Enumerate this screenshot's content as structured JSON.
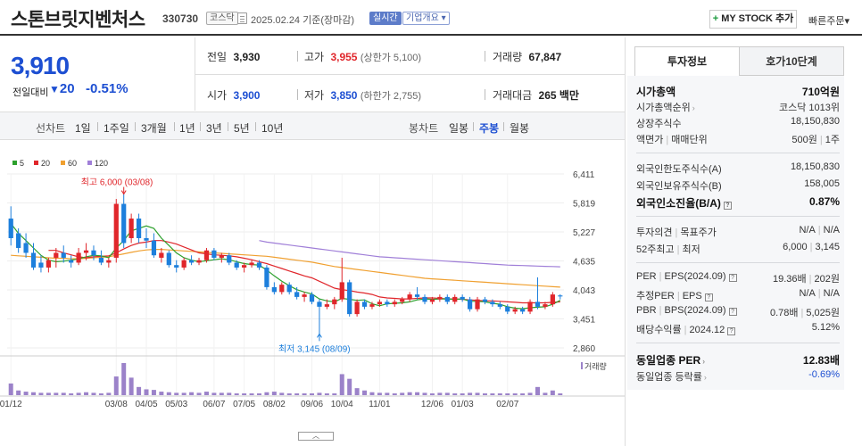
{
  "header": {
    "title": "스톤브릿지벤처스",
    "code": "330730",
    "market": "코스닥",
    "date": "2025.02.24",
    "date_suffix": "기준(장마감)",
    "realtime": "실시간",
    "company_overview": "기업개요",
    "mystock_plus": "+",
    "mystock": "MY STOCK 추가",
    "quick_order": "빠른주문"
  },
  "summary": {
    "price": "3,910",
    "change_label": "전일대비",
    "change_arrow": "▼",
    "change": "20",
    "change_rate": "-0.51%",
    "prev_label": "전일",
    "prev": "3,930",
    "high_label": "고가",
    "high": "3,955",
    "upper_limit": "(상한가 5,100)",
    "volume_label": "거래량",
    "volume": "67,847",
    "open_label": "시가",
    "open": "3,900",
    "low_label": "저가",
    "low": "3,850",
    "lower_limit": "(하한가 2,755)",
    "amount_label": "거래대금",
    "amount": "265 백만"
  },
  "period_tabs": {
    "line_chart": "선차트",
    "items": [
      "1일",
      "1주일",
      "3개월",
      "1년",
      "3년",
      "5년",
      "10년"
    ],
    "candle_chart": "봉차트",
    "candles": [
      "일봉",
      "주봉",
      "월봉"
    ],
    "active_candle": "주봉"
  },
  "colors": {
    "up": "#e0262b",
    "down": "#1d7fdc",
    "ma5": "#2ca02c",
    "ma20": "#e0262b",
    "ma60": "#f0a030",
    "ma120": "#a07fd8",
    "volume": "#9b82c9"
  },
  "chart_data": {
    "type": "candlestick",
    "legend": [
      "5",
      "20",
      "60",
      "120"
    ],
    "y_ticks": [
      "6,411",
      "5,819",
      "5,227",
      "4,635",
      "4,043",
      "3,451",
      "2,860"
    ],
    "ylim": [
      2860,
      6411
    ],
    "x_ticks": [
      "01/12",
      "03/08",
      "04/05",
      "05/03",
      "06/07",
      "07/05",
      "08/02",
      "09/06",
      "10/04",
      "11/01",
      "12/06",
      "01/03",
      "02/07"
    ],
    "high_annotation": "최고 6,000 (03/08)",
    "low_annotation": "최저 3,145 (08/09)",
    "volume_label": "거래량",
    "candles": [
      [
        5500,
        5750,
        4950,
        5100
      ],
      [
        5200,
        5300,
        4800,
        4900
      ],
      [
        5000,
        5200,
        4700,
        4800
      ],
      [
        4800,
        5000,
        4450,
        4500
      ],
      [
        4600,
        4750,
        4400,
        4500
      ],
      [
        4500,
        4700,
        4400,
        4650
      ],
      [
        4700,
        4900,
        4500,
        4800
      ],
      [
        4800,
        4950,
        4600,
        4700
      ],
      [
        4650,
        4750,
        4500,
        4600
      ],
      [
        4600,
        4900,
        4550,
        4800
      ],
      [
        4800,
        5000,
        4650,
        4850
      ],
      [
        4850,
        4950,
        4650,
        4750
      ],
      [
        4700,
        4850,
        4550,
        4600
      ],
      [
        4600,
        4700,
        4500,
        4650
      ],
      [
        4700,
        5900,
        4600,
        5800
      ],
      [
        5800,
        6000,
        4900,
        5000
      ],
      [
        5100,
        5600,
        5000,
        5500
      ],
      [
        5500,
        5600,
        5000,
        5100
      ],
      [
        5100,
        5300,
        4900,
        5050
      ],
      [
        5050,
        5200,
        4700,
        4750
      ],
      [
        4700,
        4900,
        4600,
        4800
      ],
      [
        4800,
        4850,
        4500,
        4550
      ],
      [
        4550,
        4650,
        4400,
        4500
      ],
      [
        4500,
        4700,
        4450,
        4650
      ],
      [
        4650,
        4750,
        4550,
        4600
      ],
      [
        4600,
        4700,
        4550,
        4650
      ],
      [
        4650,
        4900,
        4600,
        4850
      ],
      [
        4850,
        4900,
        4650,
        4700
      ],
      [
        4700,
        4800,
        4600,
        4750
      ],
      [
        4750,
        4800,
        4550,
        4600
      ],
      [
        4600,
        4650,
        4450,
        4500
      ],
      [
        4500,
        4600,
        4400,
        4550
      ],
      [
        4550,
        4650,
        4500,
        4600
      ],
      [
        4600,
        4650,
        4450,
        4500
      ],
      [
        4500,
        4550,
        4050,
        4100
      ],
      [
        4100,
        4200,
        3950,
        4000
      ],
      [
        4000,
        4200,
        3950,
        4150
      ],
      [
        4150,
        4200,
        3950,
        4000
      ],
      [
        4000,
        4100,
        3850,
        3900
      ],
      [
        3900,
        4000,
        3800,
        3950
      ],
      [
        3950,
        4000,
        3750,
        3800
      ],
      [
        3800,
        3850,
        3145,
        3700
      ],
      [
        3700,
        3850,
        3650,
        3750
      ],
      [
        3750,
        3900,
        3650,
        3850
      ],
      [
        3850,
        4700,
        3800,
        4200
      ],
      [
        4200,
        4250,
        3500,
        3550
      ],
      [
        3550,
        3850,
        3500,
        3800
      ],
      [
        3800,
        3850,
        3650,
        3700
      ],
      [
        3700,
        3800,
        3650,
        3750
      ],
      [
        3750,
        3850,
        3700,
        3800
      ],
      [
        3800,
        3850,
        3700,
        3750
      ],
      [
        3750,
        3850,
        3700,
        3800
      ],
      [
        3800,
        3900,
        3750,
        3850
      ],
      [
        3850,
        4000,
        3800,
        3950
      ],
      [
        3950,
        4100,
        3850,
        3900
      ],
      [
        3900,
        3950,
        3750,
        3800
      ],
      [
        3800,
        3900,
        3750,
        3850
      ],
      [
        3850,
        3950,
        3800,
        3900
      ],
      [
        3900,
        3950,
        3750,
        3800
      ],
      [
        3800,
        3950,
        3750,
        3900
      ],
      [
        3900,
        3950,
        3800,
        3850
      ],
      [
        3850,
        3900,
        3600,
        3650
      ],
      [
        3650,
        3900,
        3600,
        3850
      ],
      [
        3850,
        3900,
        3750,
        3800
      ],
      [
        3800,
        3850,
        3700,
        3750
      ],
      [
        3750,
        3800,
        3650,
        3700
      ],
      [
        3700,
        3750,
        3550,
        3600
      ],
      [
        3600,
        3700,
        3550,
        3650
      ],
      [
        3650,
        3700,
        3550,
        3600
      ],
      [
        3600,
        3850,
        3550,
        3800
      ],
      [
        3800,
        4300,
        3650,
        3700
      ],
      [
        3700,
        3800,
        3650,
        3750
      ],
      [
        3750,
        4000,
        3700,
        3950
      ],
      [
        3930,
        3955,
        3850,
        3910
      ]
    ],
    "ma5": [
      5400,
      5200,
      5050,
      4900,
      4750,
      4650,
      4620,
      4630,
      4650,
      4680,
      4720,
      4750,
      4740,
      4700,
      4900,
      5050,
      5250,
      5300,
      5350,
      5300,
      5100,
      4950,
      4800,
      4700,
      4650,
      4620,
      4640,
      4660,
      4680,
      4660,
      4620,
      4580,
      4560,
      4550,
      4450,
      4330,
      4220,
      4130,
      4050,
      4000,
      3960,
      3860,
      3820,
      3800,
      3870,
      3850,
      3830,
      3840,
      3760,
      3720,
      3760,
      3770,
      3780,
      3800,
      3840,
      3860,
      3850,
      3860,
      3860,
      3850,
      3860,
      3810,
      3810,
      3800,
      3770,
      3750,
      3700,
      3670,
      3660,
      3680,
      3690,
      3700,
      3750,
      3830
    ],
    "ma20": [
      null,
      null,
      null,
      null,
      null,
      4850,
      4850,
      4800,
      4760,
      4720,
      4700,
      4720,
      4730,
      4740,
      4800,
      4880,
      4950,
      5000,
      5020,
      5050,
      5050,
      5020,
      4980,
      4920,
      4860,
      4800,
      4780,
      4760,
      4750,
      4740,
      4720,
      4690,
      4660,
      4620,
      4580,
      4530,
      4480,
      4430,
      4380,
      4330,
      4290,
      4220,
      4150,
      4080,
      4050,
      4030,
      4000,
      3980,
      3950,
      3900,
      3880,
      3870,
      3860,
      3860,
      3870,
      3880,
      3880,
      3870,
      3860,
      3860,
      3850,
      3840,
      3830,
      3820,
      3820,
      3810,
      3800,
      3790,
      3780,
      3780,
      3780,
      3780,
      3790,
      3800
    ],
    "ma60": [
      4750,
      4740,
      4730,
      4720,
      4710,
      4700,
      4690,
      4690,
      4680,
      4680,
      4690,
      4700,
      4710,
      4720,
      4750,
      4780,
      4810,
      4840,
      4860,
      4870,
      4870,
      4860,
      4850,
      4840,
      4830,
      4820,
      4810,
      4800,
      4790,
      4780,
      4770,
      4760,
      4750,
      4740,
      4730,
      4710,
      4690,
      4670,
      4650,
      4630,
      4610,
      4580,
      4550,
      4520,
      4500,
      4480,
      4460,
      4440,
      4420,
      4400,
      4380,
      4360,
      4340,
      4320,
      4300,
      4280,
      4270,
      4260,
      4250,
      4240,
      4230,
      4220,
      4210,
      4200,
      4190,
      4180,
      4170,
      4160,
      4150,
      4140,
      4130,
      4120,
      4110,
      4100
    ],
    "ma120": [
      null,
      null,
      null,
      null,
      null,
      null,
      null,
      null,
      null,
      null,
      null,
      null,
      null,
      null,
      null,
      null,
      null,
      null,
      null,
      null,
      null,
      null,
      null,
      null,
      null,
      null,
      null,
      null,
      null,
      null,
      null,
      null,
      null,
      5050,
      5020,
      5000,
      4980,
      4960,
      4940,
      4920,
      4900,
      4880,
      4860,
      4840,
      4820,
      4800,
      4780,
      4760,
      4740,
      4720,
      4710,
      4700,
      4690,
      4680,
      4670,
      4660,
      4650,
      4640,
      4630,
      4620,
      4610,
      4600,
      4590,
      4580,
      4570,
      4560,
      4550,
      4545,
      4540,
      4535,
      4530,
      4525,
      4520,
      4515
    ],
    "volumes": [
      20,
      8,
      6,
      5,
      4,
      4,
      4,
      4,
      3,
      4,
      5,
      4,
      3,
      4,
      32,
      55,
      30,
      14,
      10,
      9,
      6,
      5,
      4,
      4,
      5,
      4,
      6,
      4,
      4,
      4,
      3,
      3,
      3,
      3,
      5,
      6,
      4,
      3,
      3,
      3,
      3,
      4,
      3,
      3,
      36,
      28,
      12,
      8,
      5,
      4,
      4,
      3,
      4,
      5,
      5,
      4,
      3,
      4,
      4,
      3,
      3,
      4,
      4,
      3,
      3,
      3,
      3,
      3,
      3,
      4,
      14,
      4,
      8,
      3
    ]
  },
  "investment_info": {
    "tab_info": "투자정보",
    "tab_ask": "호가10단계",
    "market_cap_label": "시가총액",
    "market_cap": "710억원",
    "market_cap_rank_label": "시가총액순위",
    "market_cap_rank": "코스닥 1013위",
    "listed_shares_label": "상장주식수",
    "listed_shares": "18,150,830",
    "par_label": "액면가",
    "par_label2": "매매단위",
    "par": "500원",
    "trade_unit": "1주",
    "foreign_limit_label": "외국인한도주식수(A)",
    "foreign_limit": "18,150,830",
    "foreign_hold_label": "외국인보유주식수(B)",
    "foreign_hold": "158,005",
    "foreign_rate_label": "외국인소진율(B/A)",
    "foreign_rate": "0.87%",
    "opinion_label": "투자의견",
    "target_label": "목표주가",
    "opinion": "N/A",
    "target": "N/A",
    "week52_label": "52주최고",
    "week52_label2": "최저",
    "week52_high": "6,000",
    "week52_low": "3,145",
    "per_label": "PER",
    "eps_label": "EPS",
    "per_period": "(2024.09)",
    "per": "19.36배",
    "eps": "202원",
    "est_per_label": "추정PER",
    "est_eps_label": "EPS",
    "est_per": "N/A",
    "est_eps": "N/A",
    "pbr_label": "PBR",
    "bps_label": "BPS",
    "pbr_period": "(2024.09)",
    "pbr": "0.78배",
    "bps": "5,025원",
    "dividend_label": "배당수익률",
    "dividend_period": "2024.12",
    "dividend": "5.12%",
    "sector_per_label": "동일업종 PER",
    "sector_per": "12.83배",
    "sector_change_label": "동일업종 등락률",
    "sector_change": "-0.69%"
  },
  "scroll_handle": "︿"
}
